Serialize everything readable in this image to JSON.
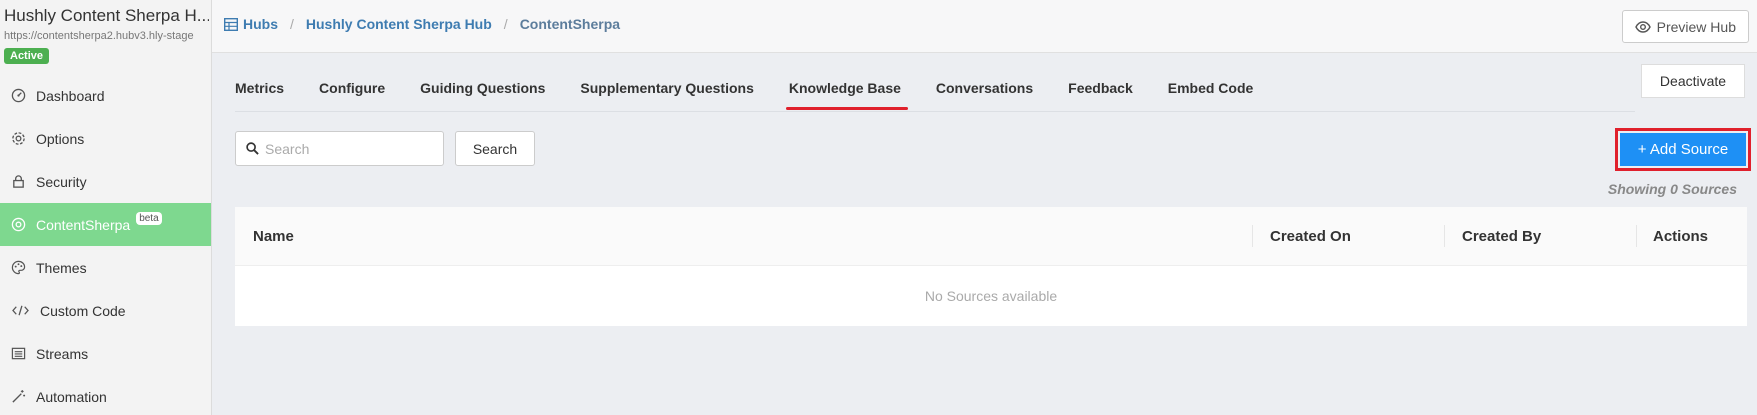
{
  "sidebar": {
    "hub_title": "Hushly Content Sherpa H...",
    "hub_url": "https://contentsherpa2.hubv3.hly-stage",
    "status": "Active",
    "items": [
      {
        "label": "Dashboard",
        "icon": "dashboard-icon"
      },
      {
        "label": "Options",
        "icon": "gear-icon"
      },
      {
        "label": "Security",
        "icon": "lock-icon"
      },
      {
        "label": "ContentSherpa",
        "icon": "sherpa-icon",
        "badge": "beta",
        "active": true
      },
      {
        "label": "Themes",
        "icon": "palette-icon"
      },
      {
        "label": "Custom Code",
        "icon": "code-icon"
      },
      {
        "label": "Streams",
        "icon": "list-icon"
      },
      {
        "label": "Automation",
        "icon": "wand-icon"
      }
    ]
  },
  "header": {
    "breadcrumb": [
      "Hubs",
      "Hushly Content Sherpa Hub",
      "ContentSherpa"
    ],
    "preview_label": "Preview Hub"
  },
  "tabs": [
    "Metrics",
    "Configure",
    "Guiding Questions",
    "Supplementary Questions",
    "Knowledge Base",
    "Conversations",
    "Feedback",
    "Embed Code"
  ],
  "active_tab": "Knowledge Base",
  "deactivate_label": "Deactivate",
  "search": {
    "placeholder": "Search",
    "value": "",
    "button_label": "Search"
  },
  "add_source_label": "+ Add Source",
  "showing_text": "Showing 0 Sources",
  "table": {
    "columns": [
      "Name",
      "Created On",
      "Created By",
      "Actions"
    ],
    "empty_text": "No Sources available"
  },
  "colors": {
    "accent": "#1e90f5",
    "active_nav": "#7ed88f",
    "highlight": "#e0202c",
    "status": "#4caf50"
  }
}
